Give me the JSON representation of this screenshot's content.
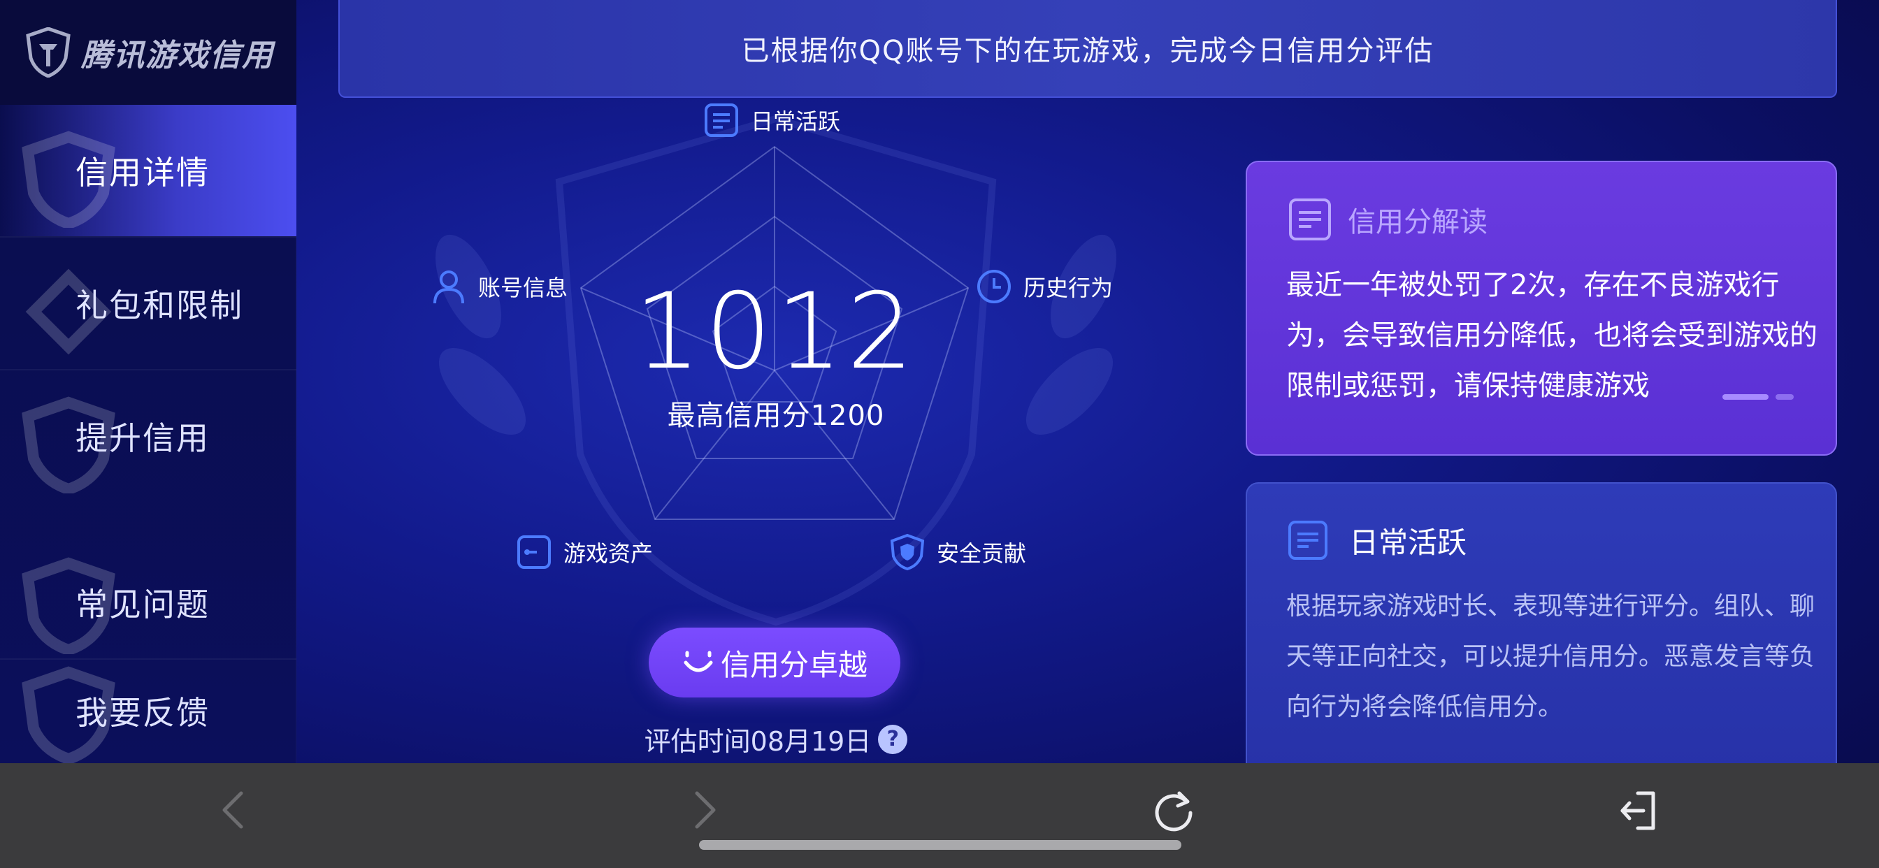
{
  "sidebar": {
    "logo_text": "腾讯游戏信用",
    "items": [
      {
        "label": "信用详情",
        "active": true
      },
      {
        "label": "礼包和限制",
        "active": false
      },
      {
        "label": "提升信用",
        "active": false
      },
      {
        "label": "常见问题",
        "active": false
      },
      {
        "label": "我要反馈",
        "active": false
      }
    ]
  },
  "banner": {
    "text": "已根据你QQ账号下的在玩游戏，完成今日信用分评估"
  },
  "radar": {
    "axes": [
      {
        "label": "日常活跃",
        "icon": "document-icon"
      },
      {
        "label": "历史行为",
        "icon": "clock-icon"
      },
      {
        "label": "安全贡献",
        "icon": "shield-icon"
      },
      {
        "label": "游戏资产",
        "icon": "wallet-icon"
      },
      {
        "label": "账号信息",
        "icon": "user-icon"
      }
    ],
    "score": "1012",
    "max_score_text": "最高信用分1200",
    "level_label": "信用分卓越",
    "eval_time": "评估时间08月19日",
    "help": "?"
  },
  "card_interpretation": {
    "title": "信用分解读",
    "body": "最近一年被处罚了2次，存在不良游戏行为，会导致信用分降低，也将会受到游戏的限制或惩罚，请保持健康游戏"
  },
  "card_daily": {
    "title": "日常活跃",
    "body": "根据玩家游戏时长、表现等进行评分。组队、聊天等正向社交，可以提升信用分。恶意发言等负向行为将会降低信用分。"
  },
  "colors": {
    "accent_purple": "#6a3cf0",
    "card_purple": "#5a30d4",
    "card_blue": "#2a34aa",
    "background": "#0b0f63",
    "icon_blue": "#4c7bff"
  },
  "browser_bar": {
    "icons": [
      "back-icon",
      "forward-icon",
      "refresh-icon",
      "exit-icon"
    ]
  }
}
